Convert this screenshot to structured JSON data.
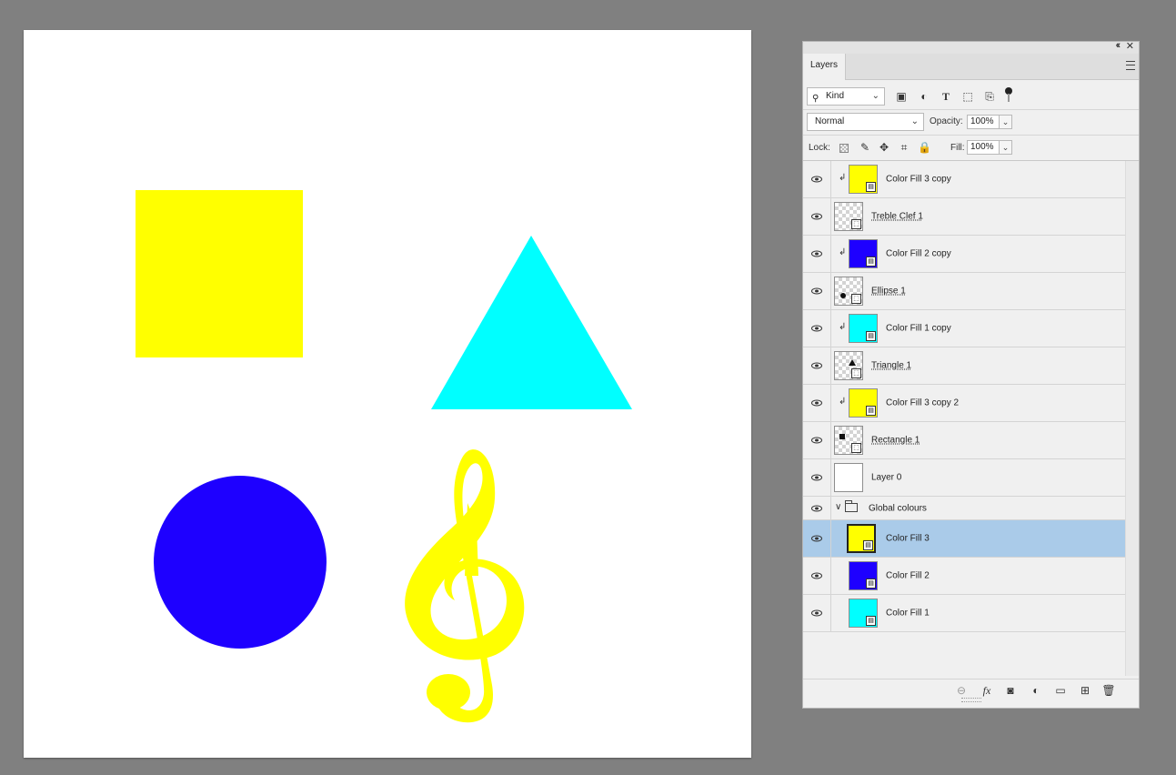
{
  "canvas": {
    "background": "#ffffff",
    "shapes": [
      {
        "name": "yellow-square",
        "color": "#ffff00"
      },
      {
        "name": "cyan-triangle",
        "color": "#00ffff"
      },
      {
        "name": "blue-circle",
        "color": "#1e00ff"
      },
      {
        "name": "yellow-treble-clef",
        "color": "#ffff00"
      }
    ]
  },
  "panel": {
    "tab_label": "Layers",
    "filter": {
      "kind_label": "Kind",
      "icons": [
        "image-filter-icon",
        "adjustment-filter-icon",
        "type-filter-icon",
        "shape-filter-icon",
        "smart-object-filter-icon"
      ]
    },
    "blend_mode": "Normal",
    "opacity_label": "Opacity:",
    "opacity_value": "100%",
    "lock_label": "Lock:",
    "fill_label": "Fill:",
    "fill_value": "100%",
    "layers": [
      {
        "name": "Color Fill 3 copy",
        "thumb": "#ffff00",
        "clipped": true,
        "shape": false
      },
      {
        "name": "Treble Clef 1",
        "thumb": "checker",
        "clipped": false,
        "shape": true
      },
      {
        "name": "Color Fill 2 copy",
        "thumb": "#1e00ff",
        "clipped": true,
        "shape": false
      },
      {
        "name": "Ellipse 1",
        "thumb": "checker",
        "clipped": false,
        "shape": true
      },
      {
        "name": "Color Fill 1 copy",
        "thumb": "#00ffff",
        "clipped": true,
        "shape": false
      },
      {
        "name": "Triangle 1",
        "thumb": "checker",
        "clipped": false,
        "shape": true
      },
      {
        "name": "Color Fill 3 copy 2",
        "thumb": "#ffff00",
        "clipped": true,
        "shape": false
      },
      {
        "name": "Rectangle 1",
        "thumb": "checker",
        "clipped": false,
        "shape": true
      },
      {
        "name": "Layer 0",
        "thumb": "#ffffff",
        "clipped": false,
        "shape": false
      }
    ],
    "group": {
      "name": "Global colours"
    },
    "group_layers": [
      {
        "name": "Color Fill 3",
        "thumb": "#ffff00",
        "selected": true
      },
      {
        "name": "Color Fill 2",
        "thumb": "#1e00ff",
        "selected": false
      },
      {
        "name": "Color Fill 1",
        "thumb": "#00ffff",
        "selected": false
      }
    ],
    "selection_color": "#aacbe9"
  }
}
